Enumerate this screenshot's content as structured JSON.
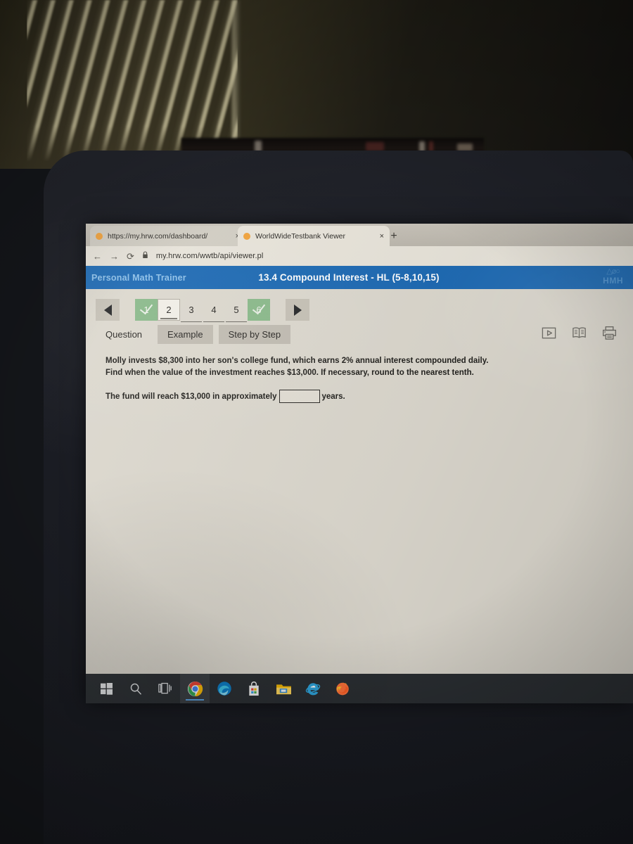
{
  "browser": {
    "tabs": [
      {
        "title": "https://my.hrw.com/dashboard/",
        "close": "×",
        "favicon": "orange-circle-favicon"
      },
      {
        "title": "WorldWideTestbank Viewer",
        "close": "×",
        "favicon": "orange-circle-favicon"
      }
    ],
    "new_tab_label": "+",
    "nav": {
      "back": "←",
      "forward": "→",
      "reload": "⟳",
      "lock": "🔒"
    },
    "url": "my.hrw.com/wwtb/api/viewer.pl"
  },
  "app": {
    "brand": "Personal Math Trainer",
    "title": "13.4 Compound Interest - HL (5-8,10,15)",
    "logo_mark": "△⌀○",
    "logo_text": "HMH",
    "header_color": "#1d6ab4",
    "brand_color": "#8fc2ea"
  },
  "pager": {
    "prev_label": "◀",
    "next_label": "▶",
    "items": [
      {
        "label": "1",
        "state": "done"
      },
      {
        "label": "2",
        "state": "current"
      },
      {
        "label": "3",
        "state": "plain"
      },
      {
        "label": "4",
        "state": "plain"
      },
      {
        "label": "5",
        "state": "plain"
      },
      {
        "label": "6",
        "state": "done"
      }
    ],
    "done_color": "#8bba8b"
  },
  "tabs": {
    "question": "Question",
    "example": "Example",
    "step_by_step": "Step by Step"
  },
  "tools": {
    "video": "video-icon",
    "textbook": "book-icon",
    "print": "printer-icon"
  },
  "question": {
    "prompt": "Molly invests $8,300 into her son's college fund, which earns 2% annual interest compounded daily. Find when the value of the investment reaches $13,000. If necessary, round to the nearest tenth.",
    "answer_prefix": "The fund will reach $13,000 in approximately",
    "answer_value": "",
    "answer_suffix": "years."
  },
  "taskbar": {
    "items": [
      {
        "name": "start",
        "label": "Start"
      },
      {
        "name": "search",
        "label": "Search"
      },
      {
        "name": "task-view",
        "label": "Task View"
      },
      {
        "name": "chrome",
        "label": "Google Chrome"
      },
      {
        "name": "edge",
        "label": "Microsoft Edge"
      },
      {
        "name": "store",
        "label": "Microsoft Store"
      },
      {
        "name": "file-explorer",
        "label": "File Explorer"
      },
      {
        "name": "internet-explorer",
        "label": "Internet Explorer"
      },
      {
        "name": "firefox",
        "label": "Mozilla Firefox"
      }
    ],
    "active": "chrome",
    "background": "#2b2f33"
  }
}
